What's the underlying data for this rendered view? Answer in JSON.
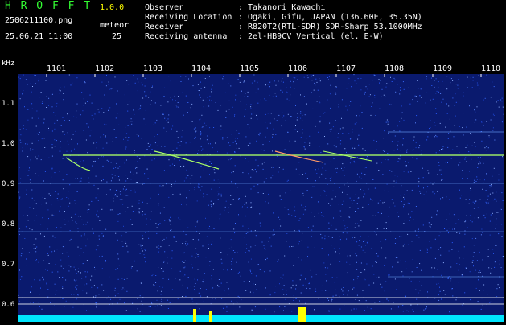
{
  "app": {
    "title_letters": "H R O F F T",
    "version": "1.0.0",
    "filename": "2506211100.png",
    "meteor_label": "meteor",
    "datetime": "25.06.21 11:00",
    "meteor_count": "25"
  },
  "meta": [
    {
      "label": "Observer",
      "value": ": Takanori Kawachi"
    },
    {
      "label": "Receiving Location",
      "value": ": Ogaki, Gifu, JAPAN (136.60E, 35.35N)"
    },
    {
      "label": "Receiver",
      "value": ": R820T2(RTL-SDR) SDR-Sharp 53.1000MHz"
    },
    {
      "label": "Receiving antenna",
      "value": ": 2el-HB9CV Vertical (el. E-W)"
    }
  ],
  "axes": {
    "y_unit": "kHz",
    "x_ticks": [
      "1101",
      "1102",
      "1103",
      "1104",
      "1105",
      "1106",
      "1107",
      "1108",
      "1109",
      "1110"
    ],
    "y_ticks": [
      "1.1",
      "1.0",
      "0.9",
      "0.8",
      "0.7",
      "0.6"
    ]
  },
  "colors": {
    "background": "#000000",
    "plot_bg": "#0a1a6e",
    "noise": "#2a5cff",
    "signal": "#aaff66",
    "bottom_bar": "#00e5ff",
    "bottom_peaks": "#ffff00"
  }
}
